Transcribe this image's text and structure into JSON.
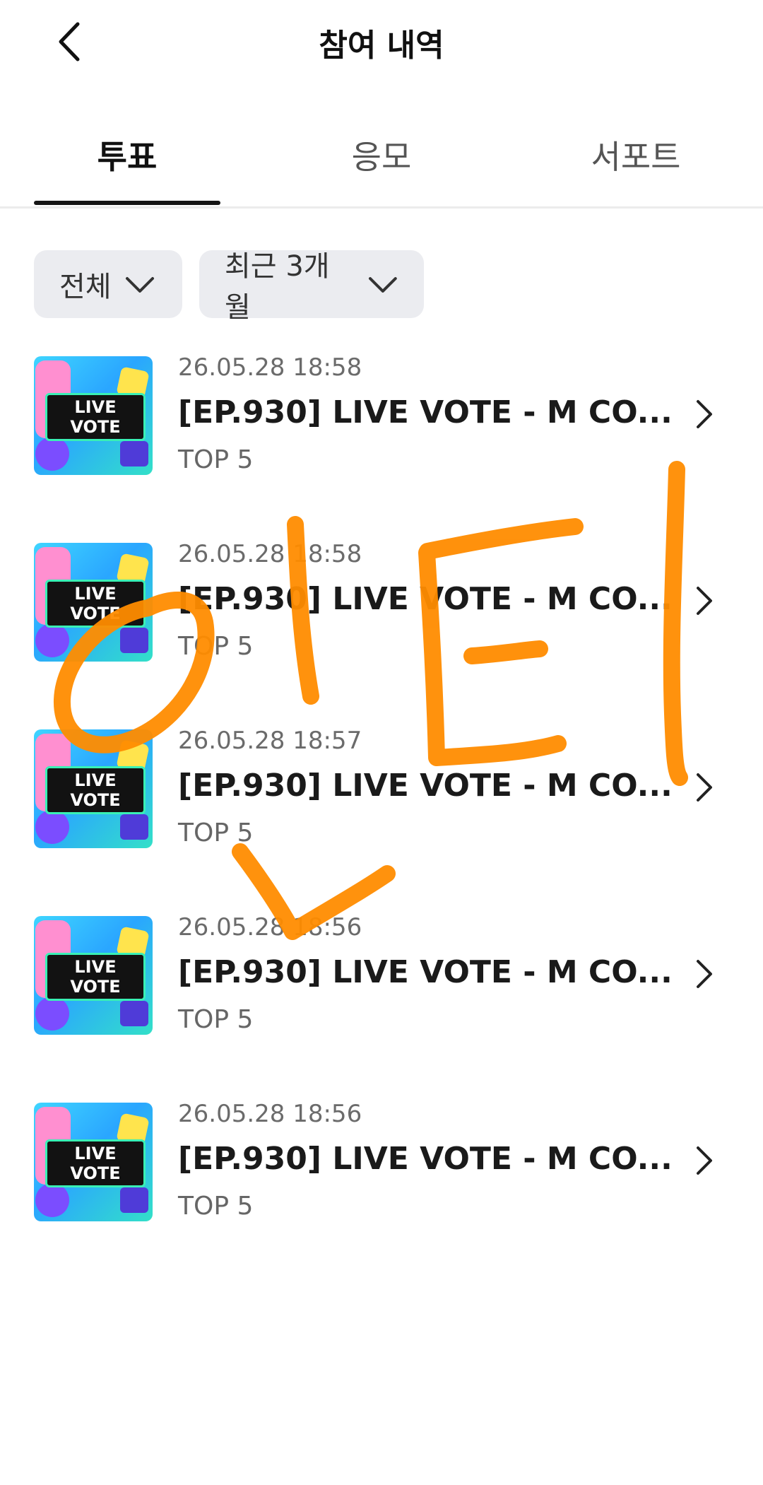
{
  "header": {
    "title": "참여 내역",
    "back_icon": "chevron-left-icon"
  },
  "tabs": [
    {
      "label": "투표",
      "active": true
    },
    {
      "label": "응모",
      "active": false
    },
    {
      "label": "서포트",
      "active": false
    }
  ],
  "filters": [
    {
      "label": "전체"
    },
    {
      "label": "최근 3개월"
    }
  ],
  "thumbnail": {
    "line1": "LIVE",
    "line2": "VOTE"
  },
  "items": [
    {
      "date": "26.05.28 18:58",
      "title": "[EP.930] LIVE VOTE - M CO...",
      "subtitle": "TOP 5"
    },
    {
      "date": "26.05.28 18:58",
      "title": "[EP.930] LIVE VOTE - M CO...",
      "subtitle": "TOP 5"
    },
    {
      "date": "26.05.28 18:57",
      "title": "[EP.930] LIVE VOTE - M CO...",
      "subtitle": "TOP 5"
    },
    {
      "date": "26.05.28 18:56",
      "title": "[EP.930] LIVE VOTE - M CO...",
      "subtitle": "TOP 5"
    },
    {
      "date": "26.05.28 18:56",
      "title": "[EP.930] LIVE VOTE - M CO...",
      "subtitle": "TOP 5"
    }
  ],
  "colors": {
    "scribble": "#ff8c00",
    "chip_bg": "#ebecf0",
    "indicator": "#151515"
  }
}
